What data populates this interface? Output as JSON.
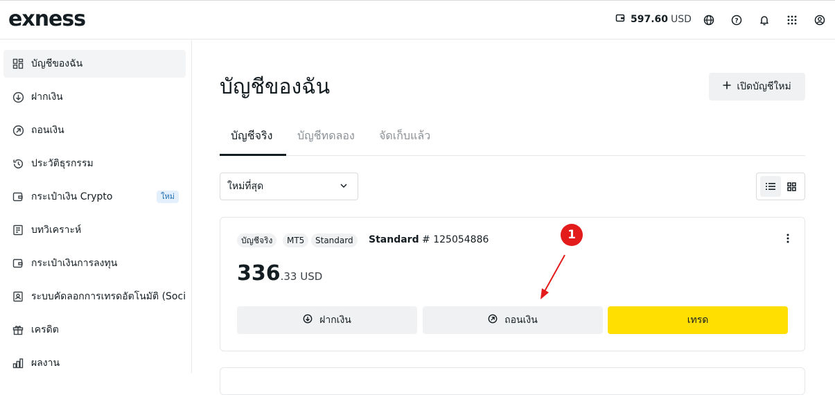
{
  "header": {
    "logo": "exness",
    "balance_amount": "597.60",
    "balance_currency": "USD",
    "icons": [
      "wallet-icon",
      "globe-icon",
      "help-icon",
      "bell-icon",
      "apps-grid-icon",
      "user-icon"
    ]
  },
  "sidebar": {
    "items": [
      {
        "label": "บัญชีของฉัน",
        "icon": "dashboard-icon",
        "active": true
      },
      {
        "label": "ฝากเงิน",
        "icon": "deposit-icon"
      },
      {
        "label": "ถอนเงิน",
        "icon": "withdraw-icon"
      },
      {
        "label": "ประวัติธุรกรรม",
        "icon": "history-icon"
      },
      {
        "label": "กระเป๋าเงิน Crypto",
        "icon": "wallet-icon",
        "badge": "ใหม่"
      },
      {
        "label": "บทวิเคราะห์",
        "icon": "analytics-icon"
      },
      {
        "label": "กระเป๋าเงินการลงทุน",
        "icon": "wallet-icon"
      },
      {
        "label": "ระบบคัดลอกการเทรดอัตโนมัติ (Social",
        "icon": "social-trading-icon"
      },
      {
        "label": "เครดิต",
        "icon": "gift-icon"
      },
      {
        "label": "ผลงาน",
        "icon": "bar-chart-icon"
      }
    ]
  },
  "main": {
    "title": "บัญชีของฉัน",
    "open_account_label": "เปิดบัญชีใหม่",
    "tabs": [
      {
        "label": "บัญชีจริง",
        "active": true
      },
      {
        "label": "บัญชีทดลอง"
      },
      {
        "label": "จัดเก็บแล้ว"
      }
    ],
    "sort_value": "ใหม่ที่สุด",
    "account_card": {
      "chips": [
        "บัญชีจริง",
        "MT5",
        "Standard"
      ],
      "account_type": "Standard",
      "account_number": "# 125054886",
      "balance_int": "336",
      "balance_dec": ".33 USD",
      "buttons": {
        "deposit": "ฝากเงิน",
        "withdraw": "ถอนเงิน",
        "trade": "เทรด"
      }
    }
  },
  "annotation": {
    "number": "1",
    "color": "#e31b1b"
  },
  "colors": {
    "accent_yellow": "#ffde02",
    "button_grey": "#f0f1f2",
    "text": "#141d22"
  }
}
